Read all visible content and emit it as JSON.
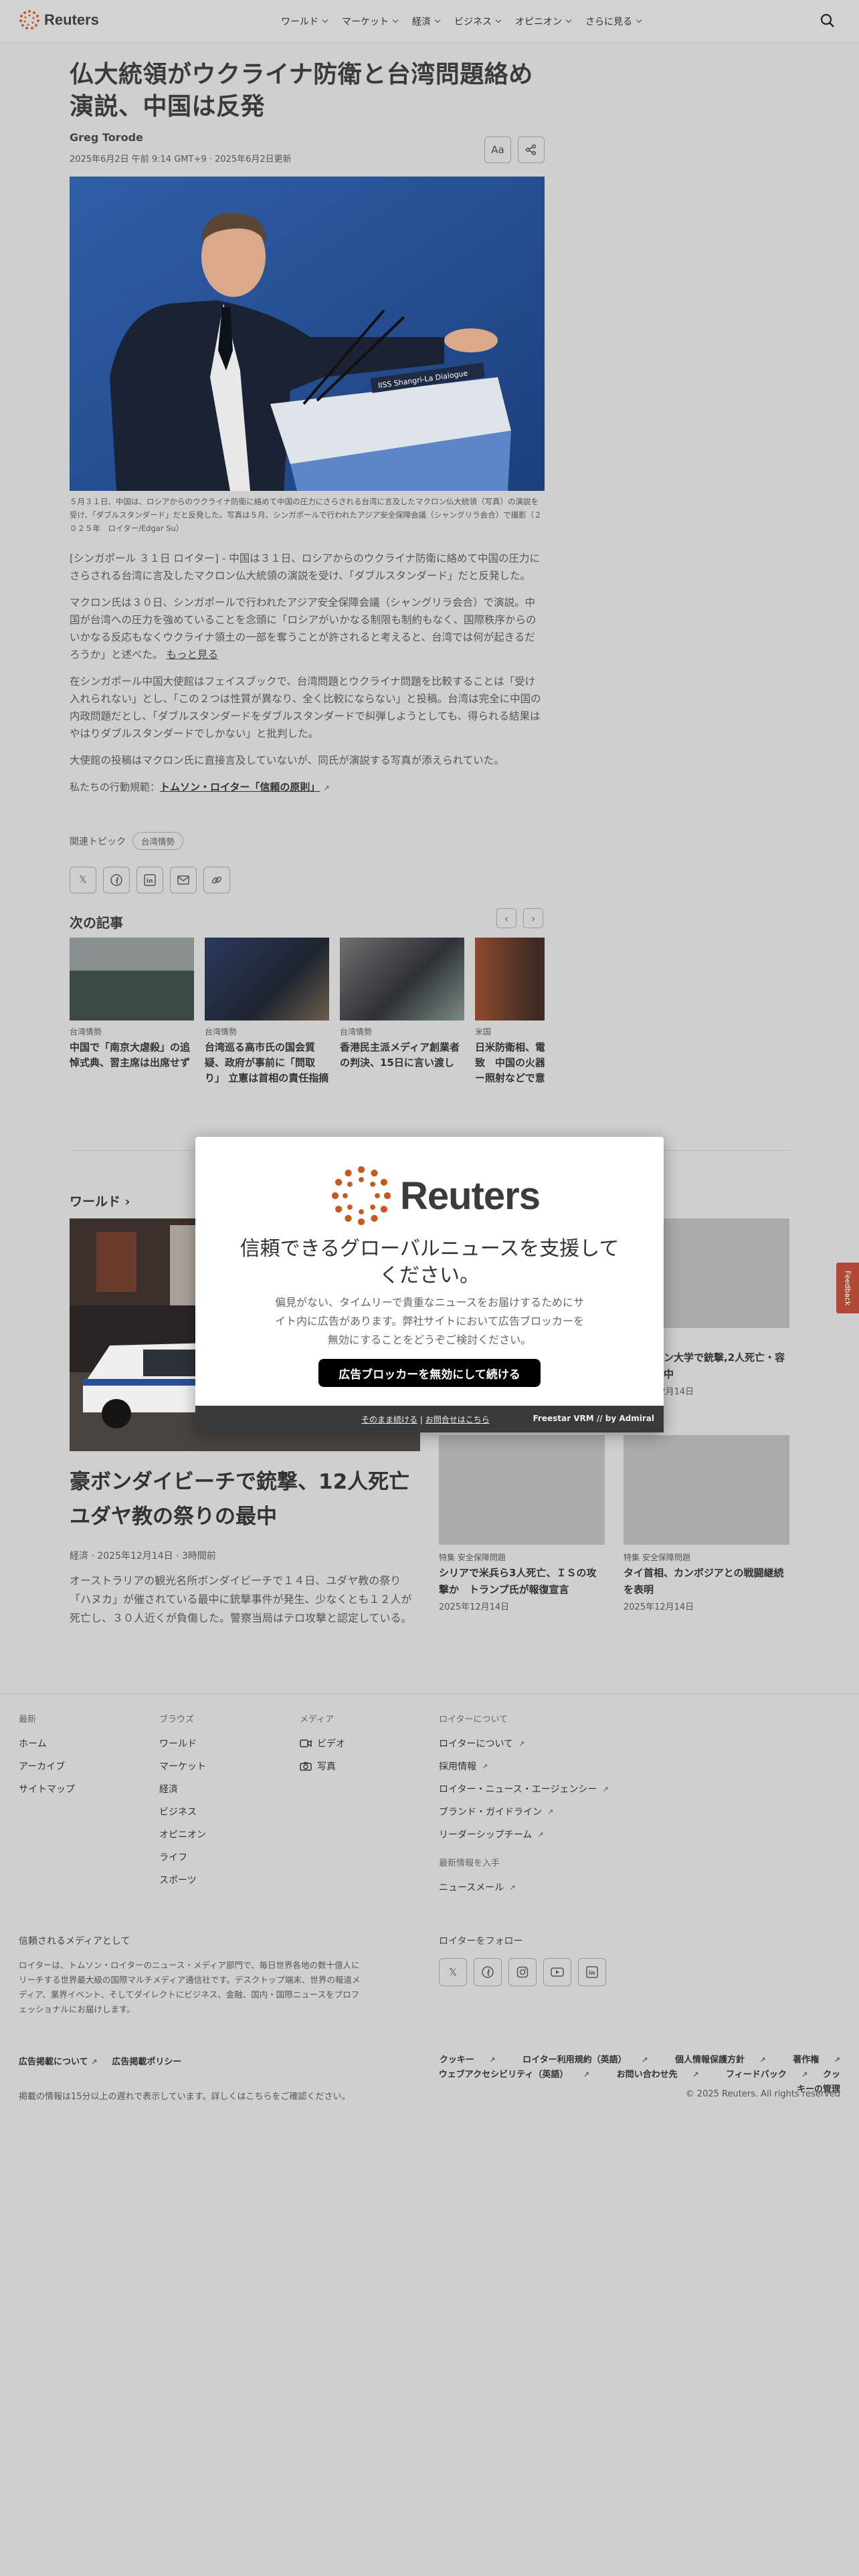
{
  "header": {
    "logo_text": "Reuters",
    "nav": [
      "ワールド",
      "マーケット",
      "経済",
      "ビジネス",
      "オピニオン",
      "さらに見る"
    ]
  },
  "article": {
    "title": "仏大統領がウクライナ防衛と台湾問題絡め演説、中国は反発",
    "author": "Greg Torode",
    "date": "2025年6月2日 午前 9:14 GMT+9 · 2025年6月2日更新",
    "text_size_label": "Aa",
    "photo_podium_text": "IISS Shangri-La Dialogue",
    "caption": "５月３１日、中国は、ロシアからのウクライナ防衛に絡めて中国の圧力にさらされる台湾に言及したマクロン仏大統領（写真）の演説を受け、「ダブルスタンダード」だと反発した。写真は５月、シンガポールで行われたアジア安全保障会議（シャングリラ会合）で撮影（２０２５年　ロイター/Edgar Su）",
    "paragraphs": [
      "[シンガポール ３１日 ロイター] - 中国は３１日、ロシアからのウクライナ防衛に絡めて中国の圧力にさらされる台湾に言及したマクロン仏大統領の演説を受け、「ダブルスタンダード」だと反発した。",
      "マクロン氏は３０日、シンガポールで行われたアジア安全保障会議（シャングリラ会合）で演説。中国が台湾への圧力を強めていることを念頭に「ロシアがいかなる制限も制約もなく、国際秩序からのいかなる反応もなくウクライナ領土の一部を奪うことが許されると考えると、台湾では何が起きるだろうか」と述べた。",
      "在シンガポール中国大使館はフェイスブックで、台湾問題とウクライナ問題を比較することは「受け入れられない」とし、「この２つは性質が異なり、全く比較にならない」と投稿。台湾は完全に中国の内政問題だとし、「ダブルスタンダードをダブルスタンダードで糾弾しようとしても、得られる結果はやはりダブルスタンダードでしかない」と批判した。",
      "大使館の投稿はマクロン氏に直接言及していないが、同氏が演説する写真が添えられていた。"
    ],
    "more_label": "もっと見る",
    "principles_prefix": "私たちの行動規範：",
    "principles_link": "トムソン・ロイター「信頼の原則」",
    "topics_label": "関連トピック",
    "topic": "台湾情勢"
  },
  "next": {
    "heading": "次の記事",
    "cards": [
      {
        "kicker": "台湾情勢",
        "title": "中国で「南京大虐殺」の追悼式典、習主席は出席せず"
      },
      {
        "kicker": "台湾情勢",
        "title": "台湾巡る高市氏の国会質疑、政府が事前に「問取り」 立憲は首相の責任指摘"
      },
      {
        "kicker": "台湾情勢",
        "title": "香港民主派メディア創業者の判決、15日に言い渡し"
      },
      {
        "kicker": "米国",
        "title": "日米防衛相、電話会談で一致　中国の火器管制レーダー照射などで意見交換"
      }
    ]
  },
  "world": {
    "heading": "ワールド",
    "main_title": "豪ボンダイビーチで銃撃、12人死亡　ユダヤ教の祭りの最中",
    "main_meta": "経済 · 2025年12月14日 · 3時間前",
    "main_desc": "オーストラリアの観光名所ボンダイビーチで１４日、ユダヤ教の祭り「ハヌカ」が催されている最中に銃撃事件が発生、少なくとも１２人が死亡し、３０人近くが負傷した。警察当局はテロ攻撃と認定している。",
    "side": [
      {
        "kicker": "",
        "title": "米ブラウン大学で銃撃,2人死亡・容疑者逃走中",
        "date": "2025年12月14日"
      },
      {
        "kicker": "特集 安全保障問題",
        "title": "シリアで米兵ら3人死亡、ＩＳの攻撃か　トランプ氏が報復宣言",
        "date": "2025年12月14日"
      },
      {
        "kicker": "特集 安全保障問題",
        "title": "タイ首相、カンボジアとの戦闘継続を表明",
        "date": "2025年12月14日"
      }
    ]
  },
  "feedback_label": "Feedback",
  "modal": {
    "logo_text": "Reuters",
    "heading": "信頼できるグローバルニュースを支援してください。",
    "text": "偏見がない、タイムリーで貴重なニュースをお届けするためにサイト内に広告があります。弊社サイトにおいて広告ブロッカーを無効にすることをどうぞご検討ください。",
    "button": "広告ブロッカーを無効にして続ける",
    "continue_link": "そのまま続ける",
    "contact_link": "お問合せはこちら",
    "brand": "Freestar VRM // by Admiral"
  },
  "footer": {
    "cols": [
      {
        "head": "最新",
        "items": [
          "ホーム",
          "アーカイブ",
          "サイトマップ"
        ]
      },
      {
        "head": "ブラウズ",
        "items": [
          "ワールド",
          "マーケット",
          "経済",
          "ビジネス",
          "オピニオン",
          "ライフ",
          "スポーツ"
        ]
      },
      {
        "head": "メディア",
        "items": [
          "ビデオ",
          "写真"
        ]
      },
      {
        "head": "ロイターについて",
        "items": [
          "ロイターについて",
          "採用情報",
          "ロイター・ニュース・エージェンシー",
          "ブランド・ガイドライン",
          "リーダーシップチーム"
        ]
      }
    ],
    "newsletter_head": "最新情報を入手",
    "newsletter": "ニュースメール",
    "about_head": "信頼されるメディアとして",
    "about_text": "ロイターは、トムソン・ロイターのニュース・メディア部門で、毎日世界各地の数十億人にリーチする世界最大級の国際マルチメディア通信社です。デスクトップ端末、世界の報道メディア、業界イベント、そしてダイレクトにビジネス、金融、国内・国際ニュースをプロフェッショナルにお届けします。",
    "follow_head": "ロイターをフォロー",
    "legal_left": [
      "広告掲載について",
      "広告掲載ポリシー"
    ],
    "legal_right": [
      "クッキー",
      "ロイター利用規約（英語）",
      "個人情報保護方針",
      "著作権",
      "ウェブアクセシビリティ（英語）",
      "お問い合わせ先",
      "フィードバック",
      "クッキーの管理"
    ],
    "delay_note": "掲載の情報は15分以上の遅れで表示しています。詳しくはこちらをご確認ください。",
    "copyright": "© 2025 Reuters. All rights reserved"
  }
}
